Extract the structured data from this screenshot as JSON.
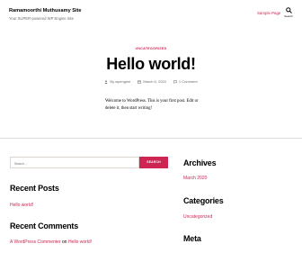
{
  "header": {
    "site_title": "Ramamoorthi Muthusamy Site",
    "site_description": "Your SUPER-powered WP Engine Site",
    "nav_link": "Sample Page",
    "search_toggle_label": "Search"
  },
  "post": {
    "category": "UNCATEGORIZED",
    "title": "Hello world!",
    "author": "By wpengine",
    "date": "March 6, 2020",
    "comments": "1 Comment",
    "body": "Welcome to WordPress. This is your first post. Edit or delete it, then start writing!"
  },
  "search": {
    "placeholder": "Search ...",
    "button_label": "SEARCH"
  },
  "sidebar_left": {
    "recent_posts_title": "Recent Posts",
    "recent_posts": [
      "Hello world!"
    ],
    "recent_comments_title": "Recent Comments",
    "recent_comment": {
      "author": "A WordPress Commenter",
      "connector": "on",
      "post": "Hello world!"
    }
  },
  "sidebar_right": {
    "archives_title": "Archives",
    "archives": [
      "March 2020"
    ],
    "categories_title": "Categories",
    "categories": [
      "Uncategorized"
    ],
    "meta_title": "Meta"
  },
  "colors": {
    "accent": "#cd2653",
    "background": "#f5efe0",
    "surface": "#ffffff",
    "muted_text": "#6d6d6d"
  },
  "icons": {
    "search_toggle": "search-icon",
    "author": "user-icon",
    "date": "calendar-icon",
    "comments": "comment-icon"
  }
}
